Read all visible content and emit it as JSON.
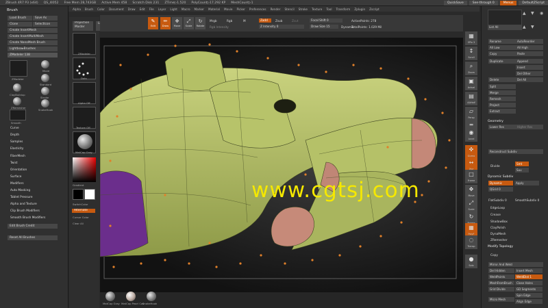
{
  "titlebar": {
    "items": [
      "ZBrush 4R7 P3 (x64)",
      "QS_4l052",
      "Free Mem 28,743GB",
      "Active Mem 458",
      "Scratch Disk 231",
      "ZTime▷1.520",
      "PolyCount▷17.292 KP",
      "MeshCount▷1"
    ],
    "quicksave": "QuickSave",
    "seethrough": "See-through 0",
    "menus_label": "Menus",
    "script_label": "DefaultZScript"
  },
  "menubar": {
    "items": [
      "Alpha",
      "Brush",
      "Color",
      "Document",
      "Draw",
      "Edit",
      "File",
      "Layer",
      "Light",
      "Macro",
      "Marker",
      "Material",
      "Movie",
      "Picker",
      "Preferences",
      "Render",
      "Stencil",
      "Stroke",
      "Texture",
      "Tool",
      "Transform",
      "Zplugin",
      "Zscript"
    ]
  },
  "brush": {
    "header": "Brush",
    "buttons": [
      "Load Brush",
      "Save As",
      "Clone",
      "SelectIcon",
      "Create InsertMesh",
      "Create InsertMultiMesh",
      "Create NanoMesh Brush",
      "Lightbox▸Brushes"
    ],
    "zmodeler": "ZModeler 138",
    "thumbs": [
      "ZModeler",
      "Move",
      "ClayBuildup",
      "Standard",
      "Stroke",
      "ZRemesher",
      "SnakeHook",
      "Smooth"
    ],
    "menu_items": [
      "Curve",
      "Depth",
      "Samples",
      "Elasticity",
      "FiberMesh",
      "Twist",
      "Orientation",
      "Surface",
      "Modifiers",
      "Auto Masking",
      "Tablet Pressure",
      "Alpha and Texture",
      "Clip Brush Modifiers",
      "Smooth Brush Modifiers"
    ],
    "edit_credit": "Edit Brush Credit",
    "reset": "Reset All Brushes"
  },
  "col2": {
    "projection": "Projection Master",
    "lightbox": "LightBox",
    "thumbs": [
      "ZModeler",
      "Dots",
      "Alpha Off",
      "Texture Off",
      "MatCap Gray"
    ],
    "gradient": "Gradient",
    "switchcolor": "SwitchColor",
    "alternate": "Alternate",
    "curvcolor": "Cursor Color",
    "clearall": "Clear All"
  },
  "toolbar": {
    "tools": [
      {
        "label": "Edit",
        "glyph": "✎",
        "active": true
      },
      {
        "label": "Draw",
        "glyph": "✏",
        "active": true
      },
      {
        "label": "Move",
        "glyph": "✥",
        "active": false
      },
      {
        "label": "Scale",
        "glyph": "⤢",
        "active": false
      },
      {
        "label": "Rotate",
        "glyph": "↻",
        "active": false
      }
    ],
    "mrgb": "Mrgb",
    "rgb": "Rgb",
    "m": "M",
    "rgb_intensity": "Rgb Intensity",
    "zadd": "Zadd",
    "zsub": "Zsub",
    "zcut": "Zcut",
    "z_intensity": "Z Intensity 0",
    "focal_shift": "Focal Shift 0",
    "draw_size": "Draw Size 15",
    "dynamic": "Dynamic",
    "active_points": "ActivePoints: 278",
    "total_points": "TotalPoints: 1.029 Mil"
  },
  "viewport": {
    "watermark": "www.cgtsj.com",
    "body_color": "#b8c46a",
    "edge_color": "#c88a78",
    "purple_color": "#6b2e8c",
    "handle_color": "#e0802a"
  },
  "rshelf": {
    "tools": [
      {
        "label": "SPix 3",
        "glyph": "▦"
      },
      {
        "label": "Scroll",
        "glyph": "↕"
      },
      {
        "label": "Zoom",
        "glyph": "⌕"
      },
      {
        "label": "Actual",
        "glyph": "▣"
      },
      {
        "label": "AAHalf",
        "glyph": "▤"
      },
      {
        "label": "Persp",
        "glyph": "▱"
      },
      {
        "label": "Floor",
        "glyph": "═"
      },
      {
        "label": "Local",
        "glyph": "◉"
      },
      {
        "label": "Gizmo",
        "glyph": "✜"
      },
      {
        "label": "Xyz",
        "glyph": "↔"
      },
      {
        "label": "Frame",
        "glyph": "□"
      },
      {
        "label": "Move",
        "glyph": "✥"
      },
      {
        "label": "Scale",
        "glyph": "⤢"
      },
      {
        "label": "Rotate",
        "glyph": "↻"
      },
      {
        "label": "PolyF",
        "glyph": "▦"
      },
      {
        "label": "Transp",
        "glyph": "◌"
      },
      {
        "label": "Solo",
        "glyph": "●"
      }
    ]
  },
  "rpanel": {
    "list_all": "List All",
    "subtool_buttons": [
      "Rename",
      "AutoReorder",
      "All Low",
      "All High",
      "Copy",
      "Paste",
      "Duplicate",
      "Append",
      "Insert",
      "Del Other",
      "Delete",
      "Del All",
      "Split",
      "Merge",
      "Remesh",
      "Project",
      "Extract"
    ],
    "geometry": "Geometry",
    "lower_res": "Lower Res",
    "higher_res": "Higher Res",
    "reconstruct": "Reconstruct Subdiv",
    "divide": "Divide",
    "smt": "Smt",
    "suv": "Suv",
    "dynamic_subdiv": "Dynamic Subdiv",
    "dynamic": "Dynamic",
    "apply": "Apply",
    "qgrid": "QGrid 0",
    "flatsubdiv": "FlatSubdiv 0",
    "smoothsubdiv": "SmoothSubdiv 0",
    "edgeloop": "EdgeLoop",
    "crease": "Crease",
    "shadowbox": "ShadowBox",
    "claypolish": "ClayPolish",
    "dynamesh": "DynaMesh",
    "zremesher": "ZRemesher",
    "modify_topology": "Modify Topology",
    "copy": "Copy",
    "mirror_weld": "Mirror And Weld",
    "del_hidden": "Del Hidden",
    "insert_mesh": "Insert Mesh",
    "weldpoints": "WeldPoints",
    "weld_dist": "WeldDist 1",
    "meshfrombrush": "MeshFromBrush",
    "close_holes": "Close Holes",
    "grid_divide": "Grid Divide",
    "gd_segments": "GD Segments",
    "spin_edge": "Spin Edge",
    "micro_mesh": "Micro Mesh",
    "align_edge": "Align Edge"
  },
  "tray": {
    "items": [
      "MatCap Gray",
      "MatCap Pearl Cav",
      "SnakeHook"
    ]
  }
}
